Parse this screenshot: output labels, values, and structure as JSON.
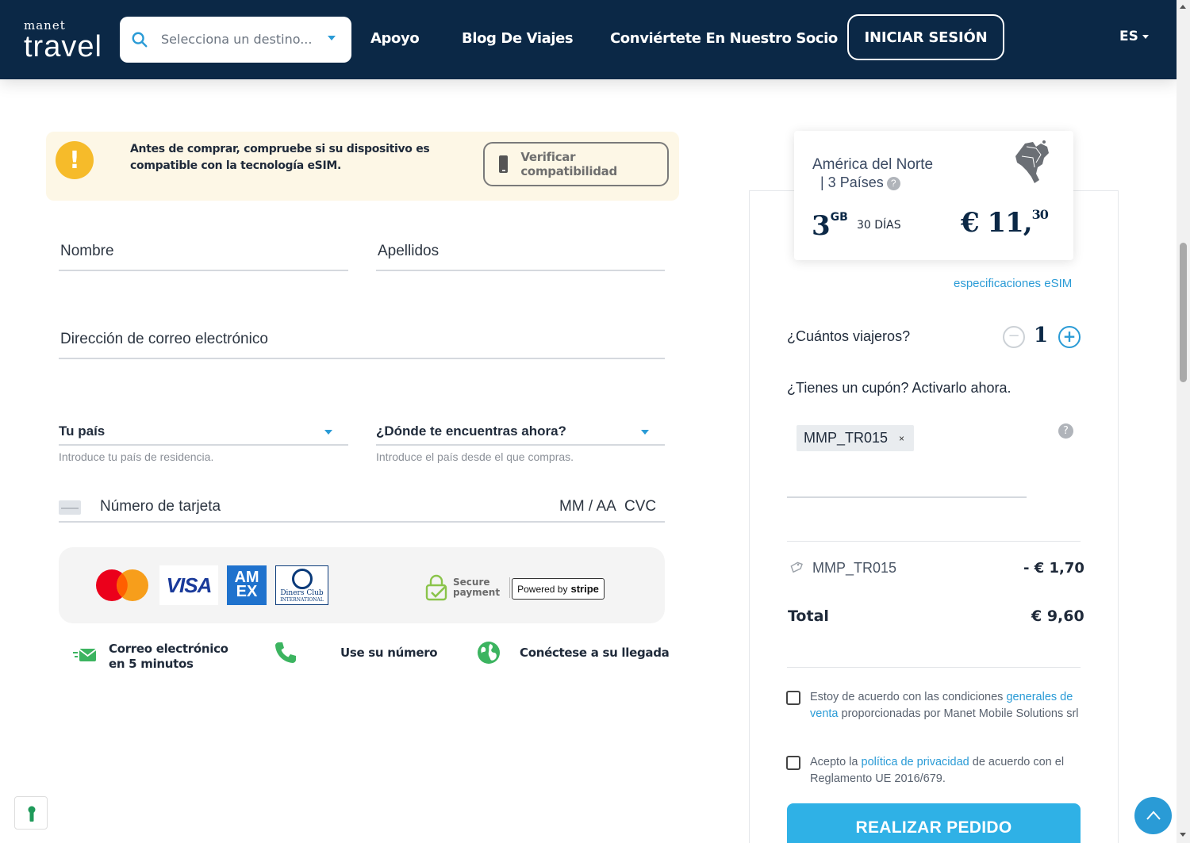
{
  "header": {
    "logo_top": "manet",
    "logo_main": "travel",
    "search_placeholder": "Selecciona un destino...",
    "nav": [
      "Apoyo",
      "Blog De Viajes",
      "Conviértete En Nuestro Socio"
    ],
    "login_label": "INICIAR SESIÓN",
    "language": "ES"
  },
  "warning": {
    "text": "Antes de comprar, compruebe si su dispositivo es compatible con la tecnología eSIM.",
    "button_label": "Verificar compatibilidad"
  },
  "form": {
    "first_name_label": "Nombre",
    "last_name_label": "Apellidos",
    "email_label": "Dirección de correo electrónico",
    "country_label": "Tu país",
    "country_hint": "Introduce tu país de residencia.",
    "location_label": "¿Dónde te encuentras ahora?",
    "location_hint": "Introduce el país desde el que compras.",
    "card_number_label": "Número de tarjeta",
    "expiry_label": "MM / AA",
    "cvc_label": "CVC"
  },
  "payment": {
    "visa_label": "VISA",
    "amex_label": "AM EX",
    "diners_label": "Diners Club",
    "diners_sub": "INTERNATIONAL",
    "secure_line1": "Secure",
    "secure_line2": "payment",
    "stripe_prefix": "Powered by",
    "stripe_brand": "stripe"
  },
  "features": [
    {
      "icon": "email-fast-icon",
      "label": "Correo electrónico en 5 minutos"
    },
    {
      "icon": "phone-icon",
      "label": "Use su número"
    },
    {
      "icon": "globe-icon",
      "label": "Conéctese a su llegada"
    }
  ],
  "package": {
    "region": "América del Norte",
    "countries": "| 3 Países",
    "data_amount": "3",
    "data_unit": "GB",
    "duration": "30 DÍAS",
    "price_main": "€ 11,",
    "price_cents": "30"
  },
  "order": {
    "specs_link": "especificaciones eSIM",
    "travelers_label": "¿Cuántos viajeros?",
    "travelers_count": "1",
    "coupon_label": "¿Tienes un cupón? Activarlo ahora.",
    "coupon_code": "MMP_TR015",
    "discount_code": "MMP_TR015",
    "discount_value": "- € 1,70",
    "total_label": "Total",
    "total_value": "€ 9,60",
    "terms1_pre": "Estoy de acuerdo con las condiciones ",
    "terms1_link": "generales de venta",
    "terms1_post": " proporcionadas por Manet Mobile Solutions srl",
    "terms2_pre": "Acepto la ",
    "terms2_link": "política de privacidad",
    "terms2_post": " de acuerdo con el Reglamento UE 2016/679.",
    "submit_label": "REALIZAR PEDIDO"
  },
  "colors": {
    "header_bg": "#0b2846",
    "accent": "#2a9bd6",
    "warning_bg": "#fdf7e6",
    "warning_icon": "#f6bb2a",
    "submit_bg": "#2fb1e6"
  }
}
